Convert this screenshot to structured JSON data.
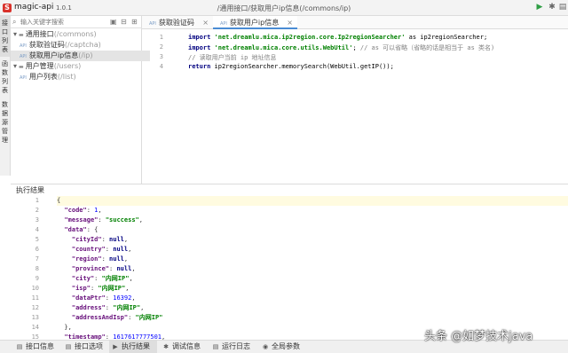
{
  "app": {
    "name": "magic-api",
    "version": "1.0.1",
    "breadcrumb": "/通用接口/获取用户ip信息(/commons/ip)"
  },
  "left_tabs": [
    "接口列表",
    "函数列表",
    "数据源管理"
  ],
  "search": {
    "placeholder": "输入关键字搜索"
  },
  "tree": [
    {
      "label": "通用接口",
      "path": "(/commons)",
      "kind": "group"
    },
    {
      "label": "获取验证码",
      "path": "(/captcha)",
      "kind": "api"
    },
    {
      "label": "获取用户ip信息",
      "path": "(/ip)",
      "kind": "api",
      "selected": true
    },
    {
      "label": "用户管理",
      "path": "(/users)",
      "kind": "group"
    },
    {
      "label": "用户列表",
      "path": "(/list)",
      "kind": "api"
    }
  ],
  "tabs": [
    {
      "tag": "API",
      "label": "获取验证码",
      "close": "×"
    },
    {
      "tag": "API",
      "label": "获取用户ip信息",
      "close": "×",
      "active": true
    }
  ],
  "code": {
    "line_numbers": [
      "1",
      "2",
      "3",
      "4"
    ],
    "lines": [
      [
        {
          "t": "import ",
          "c": "kw"
        },
        {
          "t": "'net.dreamlu.mica.ip2region.core.Ip2regionSearcher'",
          "c": "str"
        },
        {
          "t": " as ip2regionSearcher;",
          "c": ""
        }
      ],
      [
        {
          "t": "import ",
          "c": "kw"
        },
        {
          "t": "'net.dreamlu.mica.core.utils.WebUtil'",
          "c": "str"
        },
        {
          "t": "; ",
          "c": ""
        },
        {
          "t": "// as 可以省略（省略的话是相当于 as 类名)",
          "c": "cm"
        }
      ],
      [
        {
          "t": "// 读取用户当前 ip 地址信息",
          "c": "cm"
        }
      ],
      [
        {
          "t": "return ",
          "c": "kw"
        },
        {
          "t": "ip2regionSearcher.memorySearch(WebUtil.getIP());",
          "c": ""
        }
      ]
    ]
  },
  "result": {
    "title": "执行结果",
    "line_numbers": [
      "1",
      "2",
      "3",
      "4",
      "5",
      "6",
      "7",
      "8",
      "9",
      "10",
      "11",
      "12",
      "13",
      "14",
      "15"
    ],
    "lines": [
      [
        {
          "t": "{",
          "c": ""
        }
      ],
      [
        {
          "t": "  ",
          "c": ""
        },
        {
          "t": "\"code\"",
          "c": "jk"
        },
        {
          "t": ": ",
          "c": ""
        },
        {
          "t": "1",
          "c": "jn"
        },
        {
          "t": ",",
          "c": ""
        }
      ],
      [
        {
          "t": "  ",
          "c": ""
        },
        {
          "t": "\"message\"",
          "c": "jk"
        },
        {
          "t": ": ",
          "c": ""
        },
        {
          "t": "\"success\"",
          "c": "js"
        },
        {
          "t": ",",
          "c": ""
        }
      ],
      [
        {
          "t": "  ",
          "c": ""
        },
        {
          "t": "\"data\"",
          "c": "jk"
        },
        {
          "t": ": {",
          "c": ""
        }
      ],
      [
        {
          "t": "    ",
          "c": ""
        },
        {
          "t": "\"cityId\"",
          "c": "jk"
        },
        {
          "t": ": ",
          "c": ""
        },
        {
          "t": "null",
          "c": "jb"
        },
        {
          "t": ",",
          "c": ""
        }
      ],
      [
        {
          "t": "    ",
          "c": ""
        },
        {
          "t": "\"country\"",
          "c": "jk"
        },
        {
          "t": ": ",
          "c": ""
        },
        {
          "t": "null",
          "c": "jb"
        },
        {
          "t": ",",
          "c": ""
        }
      ],
      [
        {
          "t": "    ",
          "c": ""
        },
        {
          "t": "\"region\"",
          "c": "jk"
        },
        {
          "t": ": ",
          "c": ""
        },
        {
          "t": "null",
          "c": "jb"
        },
        {
          "t": ",",
          "c": ""
        }
      ],
      [
        {
          "t": "    ",
          "c": ""
        },
        {
          "t": "\"province\"",
          "c": "jk"
        },
        {
          "t": ": ",
          "c": ""
        },
        {
          "t": "null",
          "c": "jb"
        },
        {
          "t": ",",
          "c": ""
        }
      ],
      [
        {
          "t": "    ",
          "c": ""
        },
        {
          "t": "\"city\"",
          "c": "jk"
        },
        {
          "t": ": ",
          "c": ""
        },
        {
          "t": "\"内网IP\"",
          "c": "js"
        },
        {
          "t": ",",
          "c": ""
        }
      ],
      [
        {
          "t": "    ",
          "c": ""
        },
        {
          "t": "\"isp\"",
          "c": "jk"
        },
        {
          "t": ": ",
          "c": ""
        },
        {
          "t": "\"内网IP\"",
          "c": "js"
        },
        {
          "t": ",",
          "c": ""
        }
      ],
      [
        {
          "t": "    ",
          "c": ""
        },
        {
          "t": "\"dataPtr\"",
          "c": "jk"
        },
        {
          "t": ": ",
          "c": ""
        },
        {
          "t": "16392",
          "c": "jn"
        },
        {
          "t": ",",
          "c": ""
        }
      ],
      [
        {
          "t": "    ",
          "c": ""
        },
        {
          "t": "\"address\"",
          "c": "jk"
        },
        {
          "t": ": ",
          "c": ""
        },
        {
          "t": "\"内网IP\"",
          "c": "js"
        },
        {
          "t": ",",
          "c": ""
        }
      ],
      [
        {
          "t": "    ",
          "c": ""
        },
        {
          "t": "\"addressAndIsp\"",
          "c": "jk"
        },
        {
          "t": ": ",
          "c": ""
        },
        {
          "t": "\"内网IP\"",
          "c": "js"
        }
      ],
      [
        {
          "t": "  },",
          "c": ""
        }
      ],
      [
        {
          "t": "  ",
          "c": ""
        },
        {
          "t": "\"timestamp\"",
          "c": "jk"
        },
        {
          "t": ": ",
          "c": ""
        },
        {
          "t": "1617617777501",
          "c": "jn"
        },
        {
          "t": ",",
          "c": ""
        }
      ]
    ]
  },
  "bottom_tabs": [
    {
      "label": "接口信息",
      "icon": "info-icon"
    },
    {
      "label": "接口选项",
      "icon": "options-icon"
    },
    {
      "label": "执行结果",
      "icon": "play-icon",
      "active": true
    },
    {
      "label": "调试信息",
      "icon": "bug-icon"
    },
    {
      "label": "运行日志",
      "icon": "log-icon"
    },
    {
      "label": "全局参数",
      "icon": "global-icon"
    }
  ],
  "watermark": "头条 @如梦技术java",
  "colors": {
    "accent": "#4a8cd4",
    "logo": "#d9322b",
    "run": "#2e9e44"
  }
}
